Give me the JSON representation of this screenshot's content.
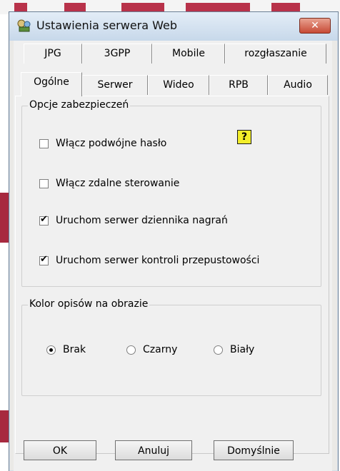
{
  "window": {
    "title": "Ustawienia serwera Web",
    "close_label": "✕"
  },
  "tabs_row1": [
    "JPG",
    "3GPP",
    "Mobile",
    "rozgłaszanie"
  ],
  "tabs_row2": [
    "Ogólne",
    "Serwer",
    "Wideo",
    "RPB",
    "Audio"
  ],
  "security": {
    "title": "Opcje zabezpieczeń",
    "options": [
      {
        "label": "Włącz podwójne hasło",
        "checked": false
      },
      {
        "label": "Włącz zdalne sterowanie",
        "checked": false
      },
      {
        "label": "Uruchom serwer dziennika nagrań",
        "checked": true
      },
      {
        "label": "Uruchom serwer kontroli przepustowości",
        "checked": true
      }
    ],
    "help_label": "?"
  },
  "color": {
    "title": "Kolor opisów na obrazie",
    "options": [
      {
        "label": "Brak",
        "checked": true
      },
      {
        "label": "Czarny",
        "checked": false
      },
      {
        "label": "Biały",
        "checked": false
      }
    ]
  },
  "buttons": {
    "ok": "OK",
    "cancel": "Anuluj",
    "default": "Domyślnie"
  }
}
